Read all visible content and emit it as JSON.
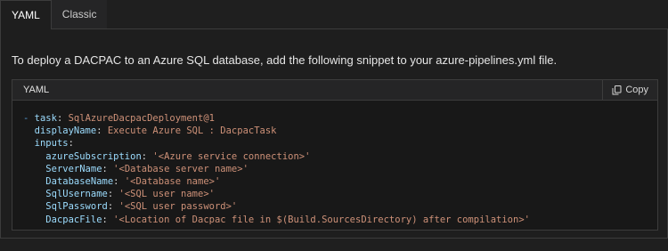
{
  "tabs": [
    {
      "label": "YAML",
      "active": true
    },
    {
      "label": "Classic",
      "active": false
    }
  ],
  "intro": "To deploy a DACPAC to an Azure SQL database, add the following snippet to your azure-pipelines.yml file.",
  "code": {
    "language": "YAML",
    "copy_label": "Copy",
    "copy_icon": "copy-icon",
    "lines": {
      "l1": {
        "dash": "- ",
        "key": "task",
        "sep": ": ",
        "value": "SqlAzureDacpacDeployment@1"
      },
      "l2": {
        "key": "displayName",
        "sep": ": ",
        "value": "Execute Azure SQL : DacpacTask"
      },
      "l3": {
        "key": "inputs",
        "sep": ":"
      },
      "l4": {
        "key": "azureSubscription",
        "sep": ": ",
        "value": "'<Azure service connection>'"
      },
      "l5": {
        "key": "ServerName",
        "sep": ": ",
        "value": "'<Database server name>'"
      },
      "l6": {
        "key": "DatabaseName",
        "sep": ": ",
        "value": "'<Database name>'"
      },
      "l7": {
        "key": "SqlUsername",
        "sep": ": ",
        "value": "'<SQL user name>'"
      },
      "l8": {
        "key": "SqlPassword",
        "sep": ": ",
        "value": "'<SQL user password>'"
      },
      "l9": {
        "key": "DacpacFile",
        "sep": ": ",
        "value": "'<Location of Dacpac file in $(Build.SourcesDirectory) after compilation>'"
      }
    }
  },
  "colors": {
    "key": "#9cdcfe",
    "string": "#ce9178",
    "punctuation": "#569cd6",
    "background": "#1e1e1e"
  }
}
